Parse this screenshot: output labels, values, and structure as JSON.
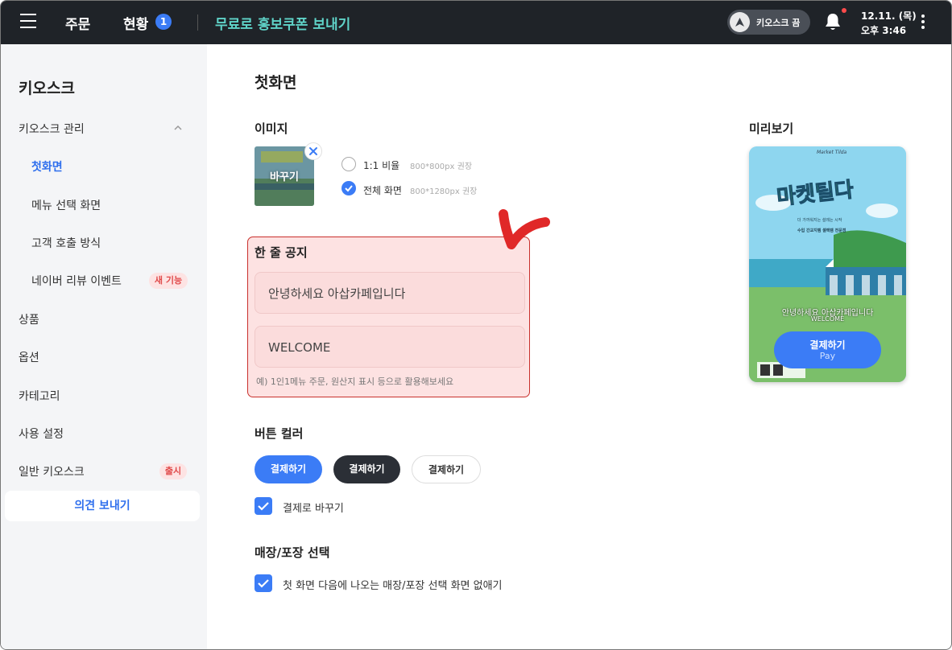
{
  "topbar": {
    "orders": "주문",
    "status": "현황",
    "status_count": "1",
    "promo": "무료로 홍보쿠폰 보내기",
    "kiosk_toggle": "키오스크 끔",
    "date": "12.11. (목)",
    "time": "오후 3:46"
  },
  "sidebar": {
    "title": "키오스크",
    "kiosk_manage": "키오스크 관리",
    "first_screen": "첫화면",
    "menu_select": "메뉴 선택 화면",
    "customer_call": "고객 호출 방식",
    "naver_review": "네이버 리뷰 이벤트",
    "new_feature_badge": "새 기능",
    "products": "상품",
    "options": "옵션",
    "categories": "카테고리",
    "settings": "사용 설정",
    "general_kiosk": "일반 키오스크",
    "release_badge": "출시",
    "feedback": "의견 보내기"
  },
  "main": {
    "title": "첫화면",
    "image_label": "이미지",
    "thumb_change": "바꾸기",
    "ratio_1_1": "1:1 비율",
    "ratio_1_1_hint": "800*800px 권장",
    "ratio_full": "전체 화면",
    "ratio_full_hint": "800*1280px 권장",
    "notice_label": "한 줄 공지",
    "notice_line1": "안녕하세요 아삽카페입니다",
    "notice_line2": "WELCOME",
    "notice_help": "예) 1인1메뉴 주문, 원산지 표시 등으로 활용해보세요",
    "button_color_label": "버튼 컬러",
    "color_blue": "결제하기",
    "color_dark": "결제하기",
    "color_white": "결제하기",
    "change_to_pay": "결제로 바꾸기",
    "store_pack_label": "매장/포장 선택",
    "skip_store_pack": "첫 화면 다음에 나오는 매장/포장 선택 화면 없애기"
  },
  "preview": {
    "label": "미리보기",
    "brand": "Market Tilda",
    "logo": "마켓틸다",
    "small1": "더 가까워지는 설레는 시작",
    "small2": "수입 간교지템 셀렉템 전문점",
    "notice1": "안녕하세요 아삽카페입니다",
    "notice2": "WELCOME",
    "pay": "결제하기",
    "pay_en": "Pay"
  },
  "colors": {
    "topbar": "#1f2328",
    "accent": "#3b7cf6",
    "promo": "#5fd3c8",
    "dark_button": "#2b2f36"
  }
}
